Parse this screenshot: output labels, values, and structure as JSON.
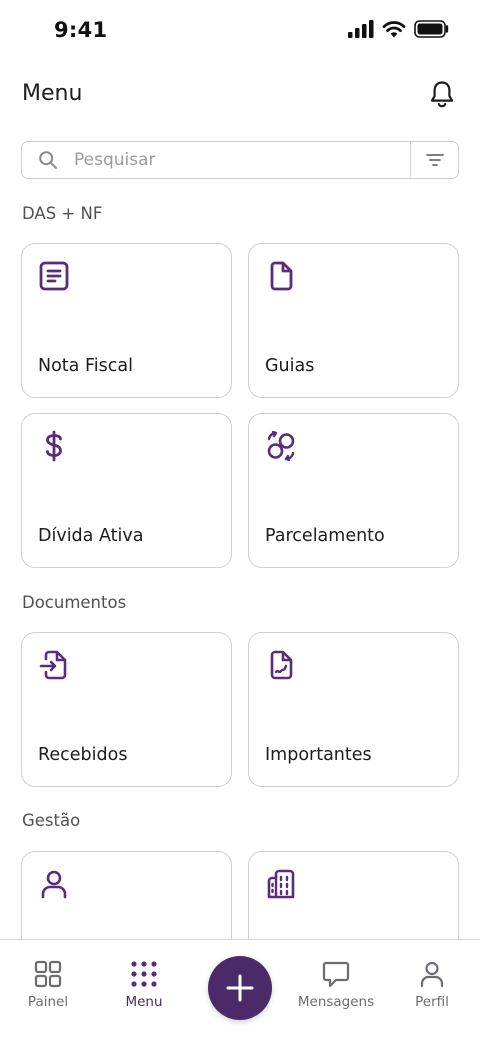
{
  "status_bar": {
    "time": "9:41"
  },
  "header": {
    "title": "Menu"
  },
  "search": {
    "placeholder": "Pesquisar",
    "value": ""
  },
  "sections": [
    {
      "label": "DAS + NF",
      "cards": [
        {
          "label": "Nota Fiscal",
          "icon": "document-lines-icon"
        },
        {
          "label": "Guias",
          "icon": "file-icon"
        },
        {
          "label": "Dívida Ativa",
          "icon": "dollar-icon"
        },
        {
          "label": "Parcelamento",
          "icon": "exchange-icon"
        }
      ]
    },
    {
      "label": "Documentos",
      "cards": [
        {
          "label": "Recebidos",
          "icon": "file-import-icon"
        },
        {
          "label": "Importantes",
          "icon": "file-signature-icon"
        }
      ]
    },
    {
      "label": "Gestão",
      "cards": [
        {
          "label": "",
          "icon": "user-icon"
        },
        {
          "label": "",
          "icon": "building-icon"
        }
      ]
    }
  ],
  "bottom_nav": {
    "items": [
      {
        "label": "Painel",
        "icon": "grid-icon"
      },
      {
        "label": "Menu",
        "icon": "dots-grid-icon",
        "active": true
      },
      {
        "label": "Mensagens",
        "icon": "message-icon"
      },
      {
        "label": "Perfil",
        "icon": "user-icon"
      }
    ],
    "fab_icon": "plus-icon"
  },
  "colors": {
    "accent": "#4b2a6a",
    "icon": "#5a2d7a",
    "border": "#cfcfd4",
    "text": "#1d1d1f",
    "muted": "#6b6b73"
  }
}
